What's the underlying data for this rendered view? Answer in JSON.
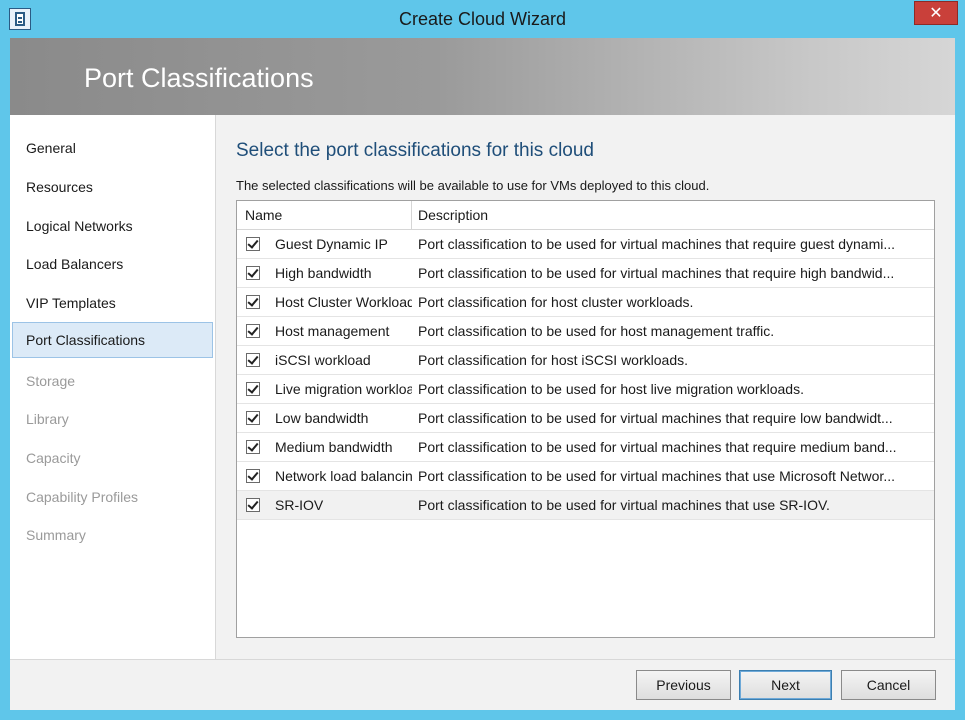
{
  "window": {
    "title": "Create Cloud Wizard",
    "close_glyph": "✕"
  },
  "banner": {
    "title": "Port Classifications"
  },
  "nav": {
    "items": [
      {
        "label": "General",
        "state": "enabled"
      },
      {
        "label": "Resources",
        "state": "enabled"
      },
      {
        "label": "Logical Networks",
        "state": "enabled"
      },
      {
        "label": "Load Balancers",
        "state": "enabled"
      },
      {
        "label": "VIP Templates",
        "state": "enabled"
      },
      {
        "label": "Port Classifications",
        "state": "selected"
      },
      {
        "label": "Storage",
        "state": "disabled"
      },
      {
        "label": "Library",
        "state": "disabled"
      },
      {
        "label": "Capacity",
        "state": "disabled"
      },
      {
        "label": "Capability Profiles",
        "state": "disabled"
      },
      {
        "label": "Summary",
        "state": "disabled"
      }
    ]
  },
  "main": {
    "heading": "Select the port classifications for this cloud",
    "subtext": "The selected classifications will be available to use for VMs deployed to this cloud.",
    "grid": {
      "columns": [
        "Name",
        "Description"
      ],
      "rows": [
        {
          "checked": true,
          "name": "Guest Dynamic IP",
          "description": "Port classification to be used for virtual machines that require guest dynami..."
        },
        {
          "checked": true,
          "name": "High bandwidth",
          "description": "Port classification to be used for virtual machines that require high bandwid..."
        },
        {
          "checked": true,
          "name": "Host Cluster Workload",
          "description": "Port classification for host cluster workloads."
        },
        {
          "checked": true,
          "name": "Host management",
          "description": "Port classification to be used for host management traffic."
        },
        {
          "checked": true,
          "name": "iSCSI workload",
          "description": "Port classification for host iSCSI workloads."
        },
        {
          "checked": true,
          "name": "Live migration  workload",
          "description": "Port classification to be used for host live migration workloads."
        },
        {
          "checked": true,
          "name": "Low bandwidth",
          "description": "Port classification to be used for virtual machines that require low bandwidt..."
        },
        {
          "checked": true,
          "name": "Medium bandwidth",
          "description": "Port classification to be used for virtual machines that require medium band..."
        },
        {
          "checked": true,
          "name": "Network load balancing",
          "description": "Port classification to be used for virtual machines that use Microsoft Networ..."
        },
        {
          "checked": true,
          "name": "SR-IOV",
          "description": "Port classification to be used for virtual machines that use SR-IOV."
        }
      ]
    }
  },
  "footer": {
    "previous_label": "Previous",
    "next_label": "Next",
    "cancel_label": "Cancel"
  }
}
